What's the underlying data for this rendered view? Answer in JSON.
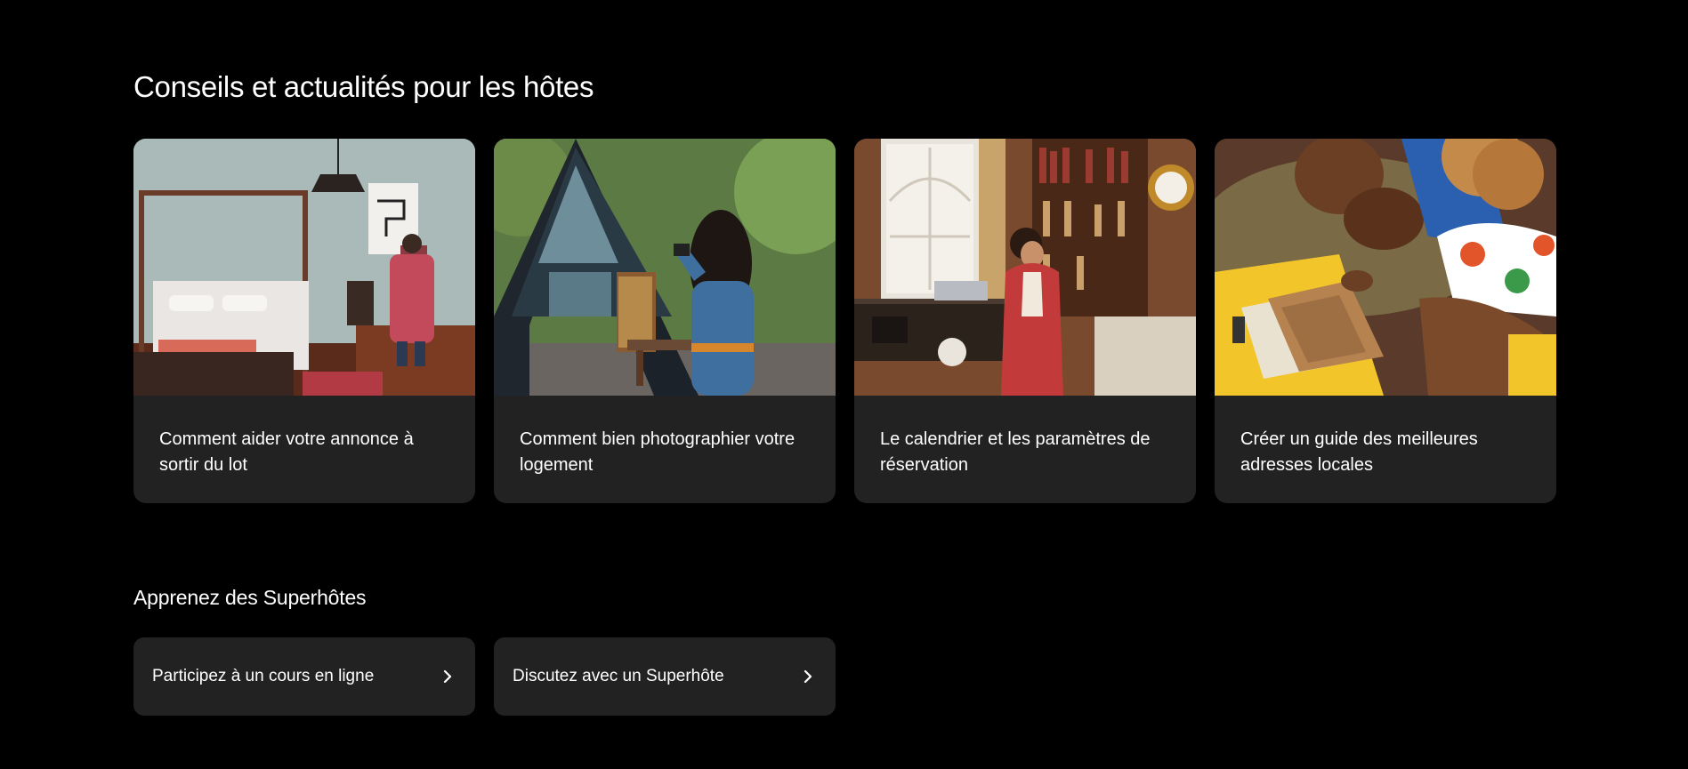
{
  "tips": {
    "title": "Conseils et actualités pour les hôtes",
    "cards": [
      {
        "label": "Comment aider votre annonce à sortir du lot"
      },
      {
        "label": "Comment bien photographier votre logement"
      },
      {
        "label": "Le calendrier et les paramètres de réservation"
      },
      {
        "label": "Créer un guide des meilleures adresses locales"
      }
    ]
  },
  "superhosts": {
    "title": "Apprenez des Superhôtes",
    "links": [
      {
        "label": "Participez à un cours en ligne",
        "icon": "chevron-right-icon"
      },
      {
        "label": "Discutez avec un Superhôte",
        "icon": "chevron-right-icon"
      }
    ]
  },
  "colors": {
    "background": "#000000",
    "card": "#222222",
    "text": "#ffffff"
  }
}
